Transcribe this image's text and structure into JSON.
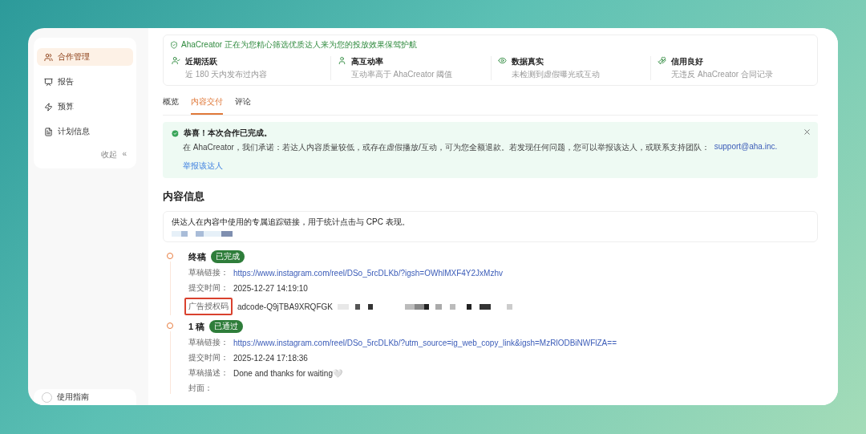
{
  "sidebar": {
    "items": [
      {
        "label": "合作管理",
        "selected": true
      },
      {
        "label": "报告",
        "selected": false
      },
      {
        "label": "预算",
        "selected": false
      },
      {
        "label": "计划信息",
        "selected": false
      }
    ],
    "collapse": {
      "label": "收起",
      "icon": "«"
    },
    "guide": {
      "label": "使用指南"
    }
  },
  "assurance": {
    "title": "AhaCreator 正在为您精心筛选优质达人来为您的投放效果保驾护航",
    "features": [
      {
        "title": "近期活跃",
        "desc": "近 180 天内发布过内容"
      },
      {
        "title": "高互动率",
        "desc": "互动率高于 AhaCreator 阈值"
      },
      {
        "title": "数据真实",
        "desc": "未检测到虚假曝光或互动"
      },
      {
        "title": "信用良好",
        "desc": "无违反 AhaCreator 合同记录"
      }
    ]
  },
  "tabs": [
    {
      "label": "概览",
      "selected": false
    },
    {
      "label": "内容交付",
      "selected": true
    },
    {
      "label": "评论",
      "selected": false
    }
  ],
  "alert": {
    "title": "恭喜！本次合作已完成。",
    "body": "在 AhaCreator，我们承诺：若达人内容质量较低，或存在虚假播放/互动，可为您全额退款。若发现任何问题，您可以举报该达人，或联系支持团队：",
    "email": "support@aha.inc.",
    "action": "举报该达人"
  },
  "content_info": {
    "heading": "内容信息",
    "tracking_note": "供达人在内容中使用的专属追踪链接，用于统计点击与 CPC 表现。"
  },
  "drafts": [
    {
      "title": "终稿",
      "badge": "已完成",
      "fields": [
        {
          "kind": "link",
          "label": "草稿链接：",
          "value": "https://www.instagram.com/reel/DSo_5rcDLKb/?igsh=OWhlMXF4Y2JxMzhv"
        },
        {
          "kind": "text",
          "label": "提交时间：",
          "value": "2025-12-27 14:19:10"
        },
        {
          "kind": "code",
          "label": "广告授权码",
          "value": "adcode-Q9jTBA9XRQFGK",
          "highlighted": true
        }
      ]
    },
    {
      "title": "1 稿",
      "badge": "已通过",
      "fields": [
        {
          "kind": "link",
          "label": "草稿链接：",
          "value": "https://www.instagram.com/reel/DSo_5rcDLKb/?utm_source=ig_web_copy_link&igsh=MzRlODBiNWFlZA=="
        },
        {
          "kind": "text",
          "label": "提交时间：",
          "value": "2025-12-24 17:18:36"
        },
        {
          "kind": "text",
          "label": "草稿描述：",
          "value": "Done and thanks for waiting🤍"
        },
        {
          "kind": "text",
          "label": "封面："
        }
      ]
    }
  ]
}
